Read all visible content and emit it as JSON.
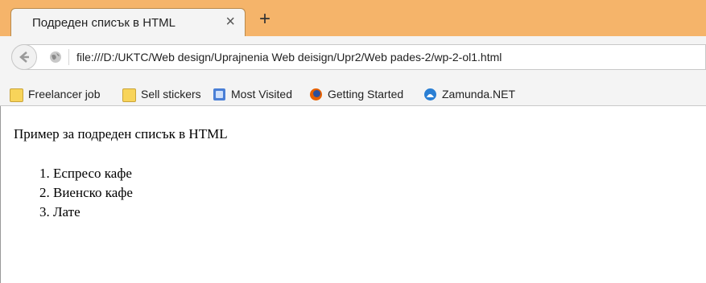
{
  "tab": {
    "title": "Подреден списък в HTML",
    "close": "×",
    "new_tab": "+"
  },
  "navbar": {
    "url": "file:///D:/UKTC/Web design/Uprajnenia Web deisign/Upr2/Web pades-2/wp-2-ol1.html"
  },
  "bookmarks": [
    {
      "label": "Freelancer job",
      "icon": "folder-icon"
    },
    {
      "label": "Sell stickers",
      "icon": "folder-icon"
    },
    {
      "label": "Most Visited",
      "icon": "most-visited-icon"
    },
    {
      "label": "Getting Started",
      "icon": "firefox-icon"
    },
    {
      "label": "Zamunda.NET",
      "icon": "site-icon"
    }
  ],
  "page": {
    "heading": "Пример за подреден списък в HTML",
    "items": [
      "1. Еспресо кафе",
      "2. Виенско кафе",
      "3. Лате"
    ]
  },
  "colors": {
    "tabstrip": "#f5b46a",
    "chrome": "#f4f4f4"
  }
}
